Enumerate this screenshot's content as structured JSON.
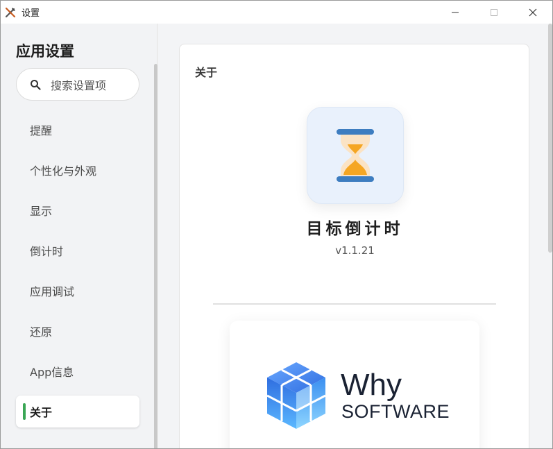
{
  "window": {
    "title": "设置",
    "controls": [
      "minimize",
      "maximize",
      "close"
    ]
  },
  "sidebar": {
    "title": "应用设置",
    "search": {
      "placeholder": "搜索设置项",
      "icon": "search-icon"
    },
    "items": [
      {
        "label": "提醒",
        "active": false
      },
      {
        "label": "个性化与外观",
        "active": false
      },
      {
        "label": "显示",
        "active": false
      },
      {
        "label": "倒计时",
        "active": false
      },
      {
        "label": "应用调试",
        "active": false
      },
      {
        "label": "还原",
        "active": false
      },
      {
        "label": "App信息",
        "active": false
      },
      {
        "label": "关于",
        "active": true
      }
    ],
    "accent": "#3aa655"
  },
  "about": {
    "section_title": "关于",
    "app_name": "目标倒计时",
    "version": "v1.1.21",
    "icon": "hourglass-icon",
    "brand": {
      "name": "Why",
      "sub": "SOFTWARE",
      "logo": "cube-logo"
    }
  },
  "colors": {
    "icon_tile": "#e9f1fc",
    "hourglass_bar": "#3d7dc0",
    "hourglass_sand": "#f5a623",
    "brand_text": "#1a2233"
  }
}
